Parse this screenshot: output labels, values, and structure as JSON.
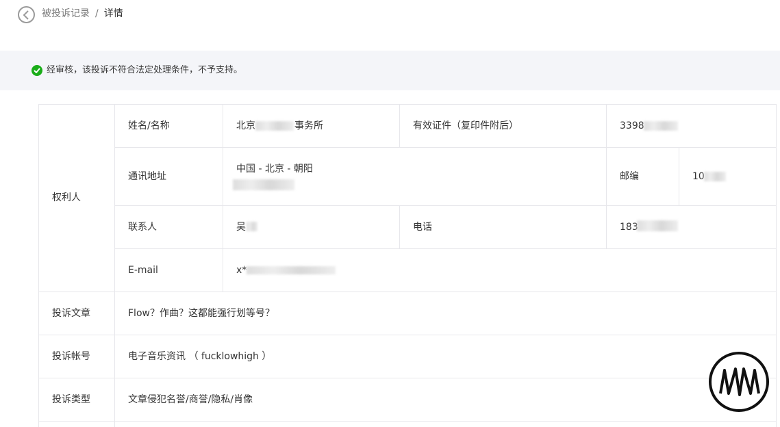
{
  "breadcrumb": {
    "parent": "被投诉记录",
    "separator": "/",
    "current": "详情"
  },
  "notice": {
    "text": "经审核，该投诉不符合法定处理条件，不予支持。",
    "status_color": "#1aad19"
  },
  "rights_holder": {
    "section_label": "权利人",
    "name_label": "姓名/名称",
    "name_prefix": "北京",
    "name_suffix": "事务所",
    "id_label": "有效证件（复印件附后）",
    "id_value": "3398",
    "address_label": "通讯地址",
    "address_line1": "中国 - 北京 - 朝阳",
    "postcode_label": "邮编",
    "postcode_value": "10",
    "contact_label": "联系人",
    "contact_value": "吴",
    "phone_label": "电话",
    "phone_value": "183",
    "email_label": "E-mail",
    "email_value": "x*"
  },
  "complaint": {
    "article_label": "投诉文章",
    "article_value": "Flow？作曲？这都能强行划等号？",
    "account_label": "投诉帐号",
    "account_value": "电子音乐资讯 （ fucklowhigh ）",
    "type_label": "投诉类型",
    "type_value": "文章侵犯名誉/商誉/隐私/肖像"
  }
}
